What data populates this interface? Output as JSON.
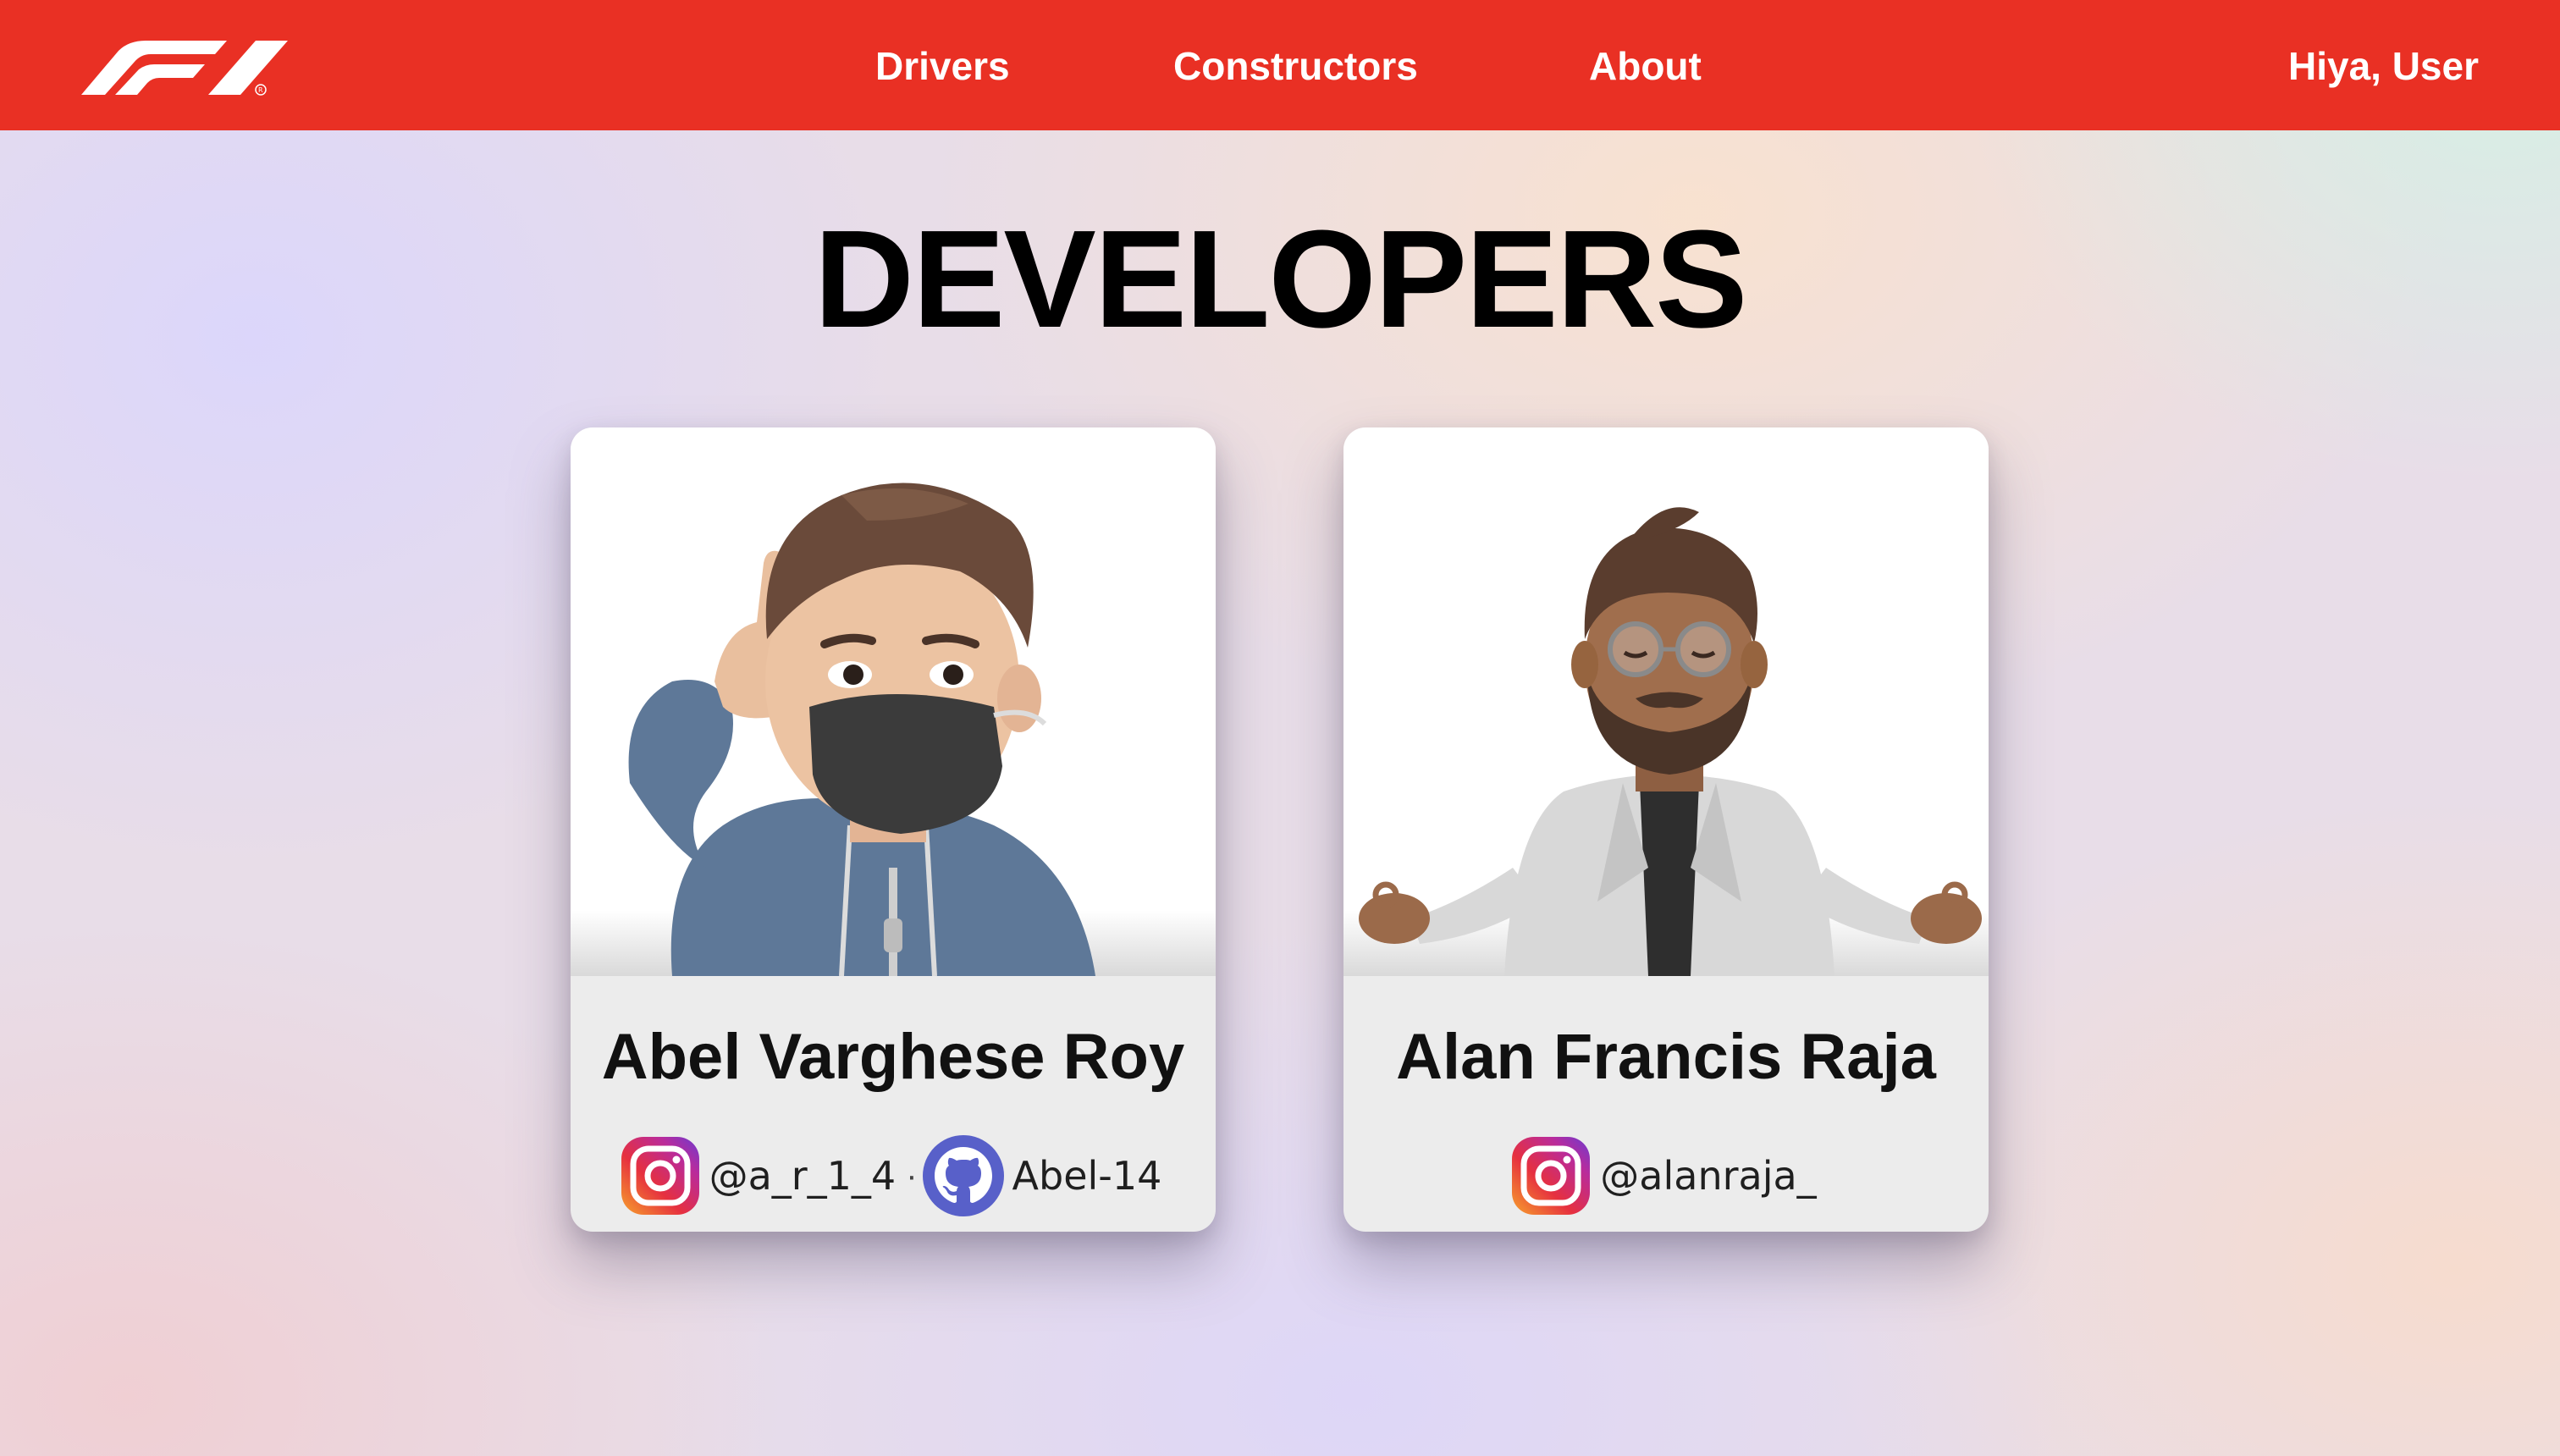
{
  "navbar": {
    "logo": "f1-logo",
    "links": [
      "Drivers",
      "Constructors",
      "About"
    ],
    "greeting": "Hiya, User",
    "colors": {
      "background": "#e93024",
      "text": "#ffffff"
    }
  },
  "main": {
    "title": "DEVELOPERS",
    "developers": [
      {
        "name": "Abel Varghese Roy",
        "avatar": "memoji-masked-boy",
        "socials": [
          {
            "icon": "instagram-icon",
            "handle": "@a_r_1_4"
          },
          {
            "icon": "github-icon",
            "handle": "Abel-14"
          }
        ]
      },
      {
        "name": "Alan Francis Raja",
        "avatar": "memoji-bearded-man",
        "socials": [
          {
            "icon": "instagram-icon",
            "handle": "@alanraja_"
          }
        ]
      }
    ]
  }
}
